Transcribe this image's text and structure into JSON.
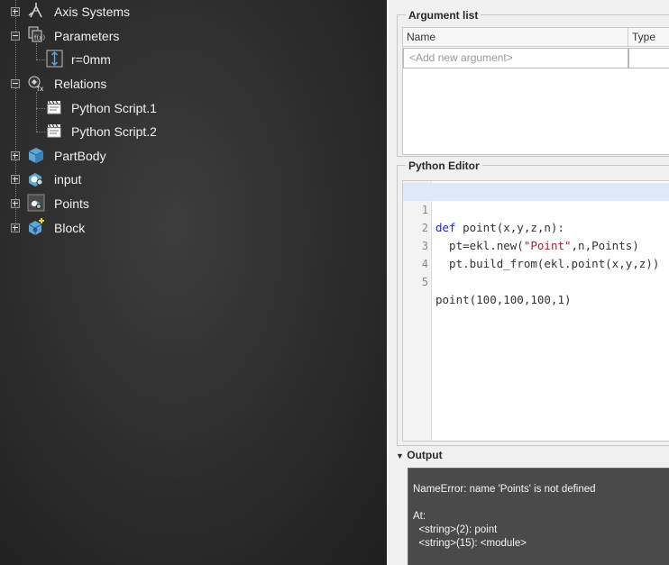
{
  "tree": {
    "nodes": [
      {
        "label": "Axis Systems",
        "icon": "axis-systems-icon",
        "expander": "plus"
      },
      {
        "label": "Parameters",
        "icon": "parameters-icon",
        "expander": "minus"
      },
      {
        "label": "r=0mm",
        "icon": "length-parameter-icon",
        "expander": "none"
      },
      {
        "label": "Relations",
        "icon": "relations-icon",
        "expander": "minus"
      },
      {
        "label": "Python Script.1",
        "icon": "script-icon",
        "expander": "none"
      },
      {
        "label": "Python Script.2",
        "icon": "script-icon",
        "expander": "none"
      },
      {
        "label": "PartBody",
        "icon": "partbody-icon",
        "expander": "plus"
      },
      {
        "label": "input",
        "icon": "geometrical-set-icon",
        "expander": "plus"
      },
      {
        "label": "Points",
        "icon": "geometrical-set-icon",
        "expander": "plus"
      },
      {
        "label": "Block",
        "icon": "block-icon",
        "expander": "plus"
      }
    ]
  },
  "argument_list": {
    "title": "Argument list",
    "columns": [
      "Name",
      "Type"
    ],
    "add_placeholder": "<Add new argument>"
  },
  "python_editor": {
    "title": "Python Editor",
    "line_numbers": [
      "1",
      "2",
      "3",
      "4",
      "5"
    ],
    "lines": [
      {
        "kw": "def",
        "rest_a": " point(x,y,z,n):",
        "str": "",
        "rest_b": ""
      },
      {
        "kw": "",
        "rest_a": "  pt=ekl.new(",
        "str": "\"Point\"",
        "rest_b": ",n,Points)"
      },
      {
        "kw": "",
        "rest_a": "  pt.build_from(ekl.point(x,y,z))",
        "str": "",
        "rest_b": ""
      },
      {
        "kw": "",
        "rest_a": "",
        "str": "",
        "rest_b": ""
      },
      {
        "kw": "",
        "rest_a": "point(100,100,100,1)",
        "str": "",
        "rest_b": ""
      }
    ],
    "highlighted_line": 1
  },
  "output": {
    "title": "Output",
    "toggle": "▼",
    "lines": [
      "NameError: name 'Points' is not defined",
      "",
      "At:",
      "  <string>(2): point",
      "  <string>(15): <module>"
    ]
  },
  "colors": {
    "tree_bg": "#2c2c2c",
    "panel_bg": "#f0f0f0",
    "output_bg": "#4a4a4a",
    "keyword": "#1e28c8",
    "string": "#b22222"
  }
}
